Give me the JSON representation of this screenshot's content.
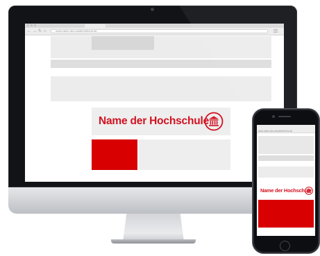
{
  "desktop": {
    "browser": {
      "url": "www.name-des-studienführers.de"
    },
    "institution_name": "Name der Hochschule",
    "emblem_icon": "university-building-icon"
  },
  "mobile": {
    "browser": {
      "url": "www.name-des-studienführers.de"
    },
    "institution_name": "Name der Hochschule",
    "emblem_icon": "university-building-icon"
  },
  "colors": {
    "brand_red": "#d2111f",
    "tile_red": "#d80000",
    "placeholder_gray": "#eeeeee"
  }
}
